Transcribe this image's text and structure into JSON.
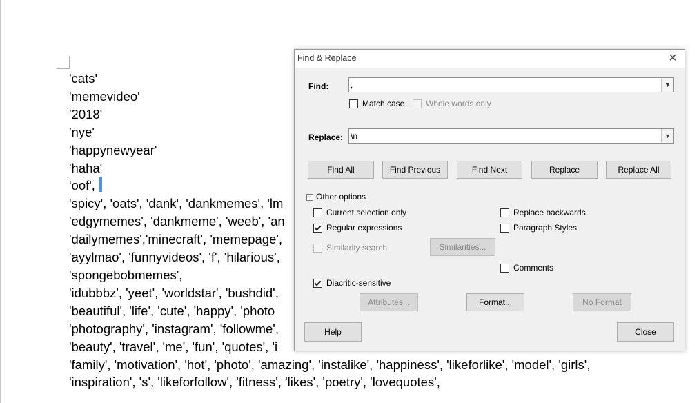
{
  "document": {
    "lines": [
      "'cats'",
      " 'memevideo'",
      "'2018'",
      " 'nye'",
      " 'happynewyear'",
      " 'haha'",
      " 'oof',",
      "'spicy', 'oats', 'dank', 'dankmemes', 'lm",
      "'edgymemes', 'dankmeme', 'weeb', 'an",
      "'dailymemes','minecraft', 'memepage',",
      "'ayylmao', 'funnyvideos', 'f', 'hilarious',",
      "'spongebobmemes',",
      "'idubbbz', 'yeet', 'worldstar', 'bushdid',",
      "'beautiful', 'life', 'cute', 'happy', 'photo",
      "'photography', 'instagram', 'followme',",
      "'beauty', 'travel', 'me', 'fun', 'quotes', 'i",
      "'family', 'motivation', 'hot', 'photo', 'amazing', 'instalike', 'happiness', 'likeforlike', 'model', 'girls',",
      "'inspiration', 's', 'likeforfollow', 'fitness', 'likes', 'poetry', 'lovequotes',"
    ]
  },
  "dialog": {
    "title": "Find & Replace",
    "find_label": "Find:",
    "find_value": ",",
    "match_case": "Match case",
    "whole_words": "Whole words only",
    "replace_label": "Replace:",
    "replace_value": "\\n",
    "buttons": {
      "find_all": "Find All",
      "find_previous": "Find Previous",
      "find_next": "Find Next",
      "replace": "Replace",
      "replace_all": "Replace All"
    },
    "other_options": "Other options",
    "options": {
      "current_selection": "Current selection only",
      "regular_expressions": "Regular expressions",
      "similarity_search": "Similarity search",
      "similarities": "Similarities...",
      "diacritic": "Diacritic-sensitive",
      "replace_backwards": "Replace backwards",
      "paragraph_styles": "Paragraph Styles",
      "comments": "Comments",
      "attributes": "Attributes...",
      "format": "Format...",
      "no_format": "No Format"
    },
    "help": "Help",
    "close": "Close"
  }
}
